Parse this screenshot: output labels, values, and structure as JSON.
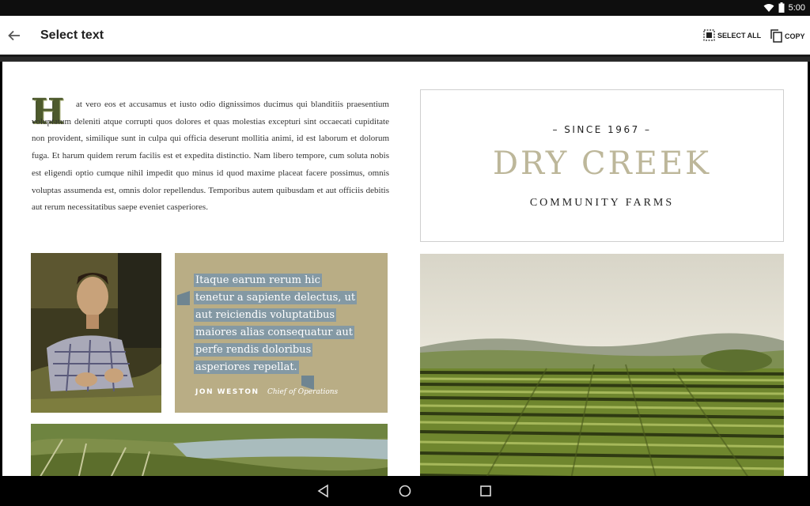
{
  "status_bar": {
    "time": "5:00",
    "icons": [
      "wifi-icon",
      "battery-icon"
    ]
  },
  "action_bar": {
    "title": "Select text",
    "select_all_label": "SELECT ALL",
    "copy_label": "COPY"
  },
  "article": {
    "drop_cap": "H",
    "body": "at vero eos et accusamus et iusto odio dignissimos ducimus qui blanditiis praesentium voluptatum deleniti atque corrupti quos dolores et quas molestias excepturi sint occaecati cupiditate non provident, similique sunt in culpa qui officia deserunt mollitia animi, id est laborum et dolorum fuga. Et harum quidem rerum facilis est et expedita distinctio. Nam libero tempore, cum soluta nobis est eligendi optio cumque nihil impedit quo minus id quod maxime placeat facere possimus, omnis voluptas assumenda est, omnis dolor repellendus. Temporibus autem quibusdam et aut officiis debitis aut rerum necessitatibus saepe eveniet casperiores."
  },
  "brand": {
    "since": "– SINCE 1967 –",
    "name": "DRY CREEK",
    "subtitle": "COMMUNITY FARMS"
  },
  "quote": {
    "lines": [
      "Itaque earum rerum hic",
      "tenetur a sapiente delectus, ut",
      "aut reiciendis voluptatibus",
      "maiores alias consequatur aut",
      "perfe rendis doloribus",
      "asperiores repellat."
    ],
    "author": "JON WESTON",
    "role": "Chief of Operations"
  },
  "colors": {
    "brand_olive": "#bdb79a",
    "quote_bg": "#b9ad85",
    "selection": "#8499a4",
    "dropcap": "#4d5a2c"
  }
}
